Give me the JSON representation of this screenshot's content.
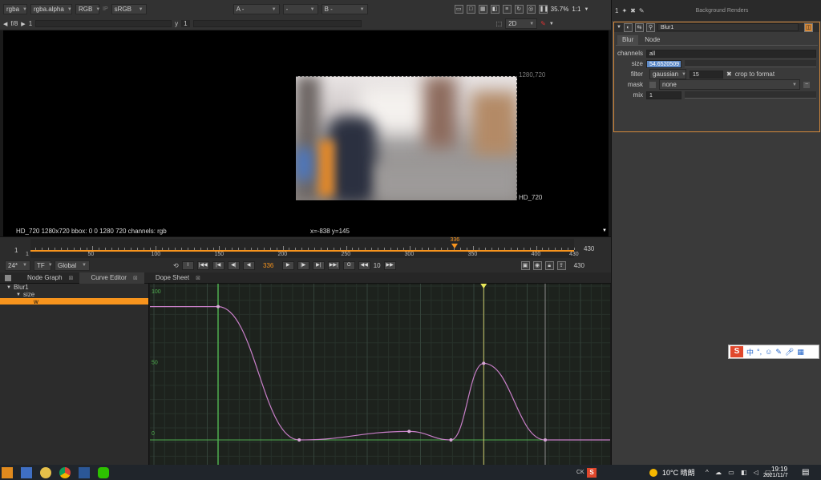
{
  "viewer": {
    "channels": "rgba",
    "alpha_channel": "rgba.alpha",
    "display": "RGB",
    "lut": "sRGB",
    "a_input": "A -",
    "comp_op": "-",
    "b_input": "B -",
    "zoom": "35.7%",
    "ratio": "1:1",
    "fstop": "f/8",
    "gain_value": "1",
    "gamma_label": "y",
    "gamma_value": "1",
    "view_mode": "2D",
    "format_top_right": "1280,720",
    "format_bottom_right": "HD_720",
    "info_left": "HD_720 1280x720  bbox: 0 0 1280 720 channels: rgb",
    "info_coords": "x=-838 y=145"
  },
  "timeline": {
    "start": "1",
    "end": "430",
    "end_field": "430",
    "ticks": [
      {
        "label": "1",
        "value": 1
      },
      {
        "label": "50",
        "value": 50
      },
      {
        "label": "100",
        "value": 100
      },
      {
        "label": "150",
        "value": 150
      },
      {
        "label": "200",
        "value": 200
      },
      {
        "label": "250",
        "value": 250
      },
      {
        "label": "300",
        "value": 300
      },
      {
        "label": "350",
        "value": 350
      },
      {
        "label": "400",
        "value": 400
      },
      {
        "label": "430",
        "value": 430
      }
    ],
    "current_frame": "336",
    "current_frame_value": 336,
    "fps": "24*",
    "tf": "TF",
    "range_mode": "Global",
    "step": "10",
    "accent": "#f7941d"
  },
  "tabs": [
    {
      "label": "Node Graph"
    },
    {
      "label": "Curve Editor"
    },
    {
      "label": "Dope Sheet"
    }
  ],
  "curve_tree": {
    "node": "Blur1",
    "knob": "size",
    "channel": "w"
  },
  "curve_editor": {
    "y_labels": [
      {
        "label": "100",
        "value": 100
      },
      {
        "label": "50",
        "value": 50
      },
      {
        "label": "0",
        "value": 0
      }
    ],
    "curve_color": "#c87fc8",
    "keyframes": [
      {
        "frame": 100,
        "value": 94
      },
      {
        "frame": 162,
        "value": 0
      },
      {
        "frame": 246,
        "value": 6
      },
      {
        "frame": 278,
        "value": 0
      },
      {
        "frame": 303,
        "value": 54
      },
      {
        "frame": 350,
        "value": 0
      }
    ]
  },
  "properties": {
    "node_name": "Blur1",
    "tabs": [
      {
        "label": "Blur"
      },
      {
        "label": "Node"
      }
    ],
    "channels_label": "channels",
    "channels_value": "all",
    "size_label": "size",
    "size_value": "54.6520509",
    "filter_label": "filter",
    "filter_value": "gaussian",
    "quality_value": "15",
    "crop_label": "crop to format",
    "mask_label": "mask",
    "mask_value": "none",
    "mix_label": "mix",
    "mix_value": "1",
    "top_right_label": "Background Renders",
    "panel_accent": "#d58a3c"
  },
  "ime_bar": {
    "logo": "S",
    "lang": "中"
  },
  "taskbar": {
    "weather": "10°C 晴朗",
    "time": "19:19",
    "date": "2021/11/7",
    "tray_text": "CK"
  }
}
